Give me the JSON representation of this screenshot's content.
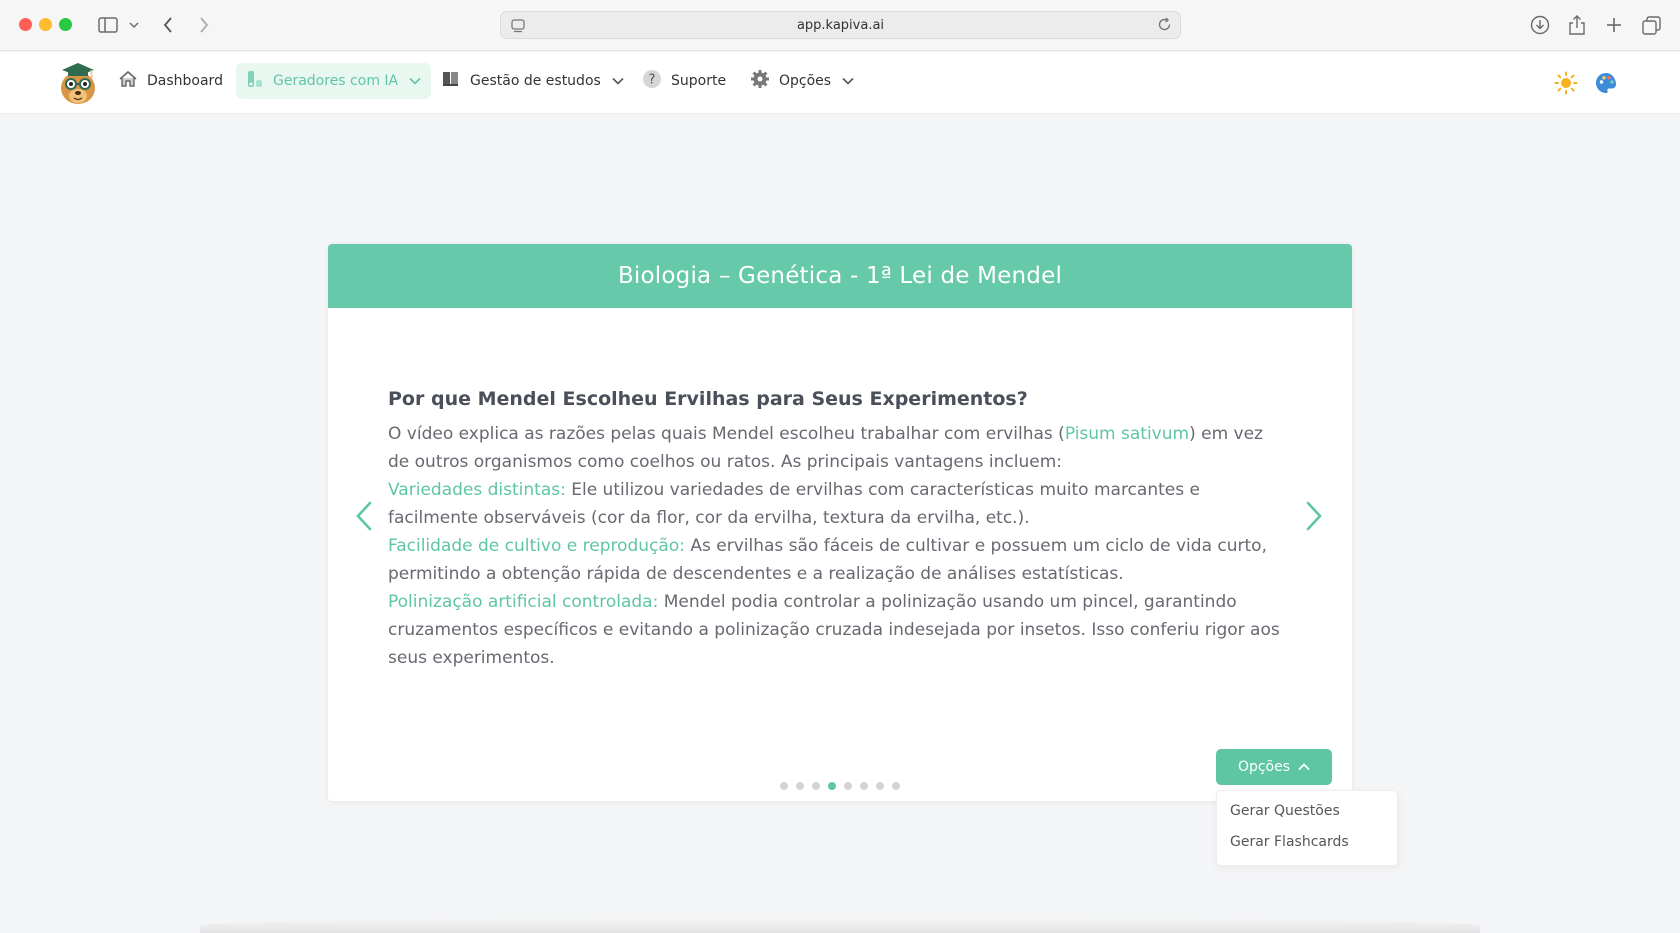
{
  "browser": {
    "url": "app.kapiva.ai"
  },
  "nav": {
    "items": [
      {
        "label": "Dashboard"
      },
      {
        "label": "Geradores com IA"
      },
      {
        "label": "Gestão de estudos"
      },
      {
        "label": "Suporte"
      },
      {
        "label": "Opções"
      }
    ]
  },
  "card": {
    "title": "Biologia – Genética - 1ª Lei de Mendel",
    "heading": "Por que Mendel Escolheu Ervilhas para Seus Experimentos?",
    "p1_a": "O vídeo explica as razões pelas quais Mendel escolheu trabalhar com ervilhas (",
    "p1_hl": "Pisum sativum",
    "p1_b": ") em vez de outros organismos como coelhos ou ratos. As principais vantagens incluem:",
    "p2_hl": "Variedades distintas:",
    "p2_b": " Ele utilizou variedades de ervilhas com características muito marcantes e facilmente observáveis (cor da flor, cor da ervilha, textura da ervilha, etc.).",
    "p3_hl": "Facilidade de cultivo e reprodução:",
    "p3_b": " As ervilhas são fáceis de cultivar e possuem um ciclo de vida curto, permitindo a obtenção rápida de descendentes e a realização de análises estatísticas.",
    "p4_hl": "Polinização artificial controlada:",
    "p4_b": " Mendel podia controlar a polinização usando um pincel, garantindo cruzamentos específicos e evitando a polinização cruzada indesejada por insetos. Isso conferiu rigor aos seus experimentos.",
    "slide_count": 8,
    "active_slide": 4
  },
  "options": {
    "button_label": "Opções",
    "menu": [
      "Gerar Questões",
      "Gerar Flashcards"
    ]
  },
  "colors": {
    "accent": "#66c9a9",
    "text_accent": "#5fc6a3"
  },
  "icons": [
    "home-icon",
    "brush-icon",
    "book-icon",
    "question-icon",
    "gear-icon",
    "sun-icon",
    "palette-icon"
  ]
}
